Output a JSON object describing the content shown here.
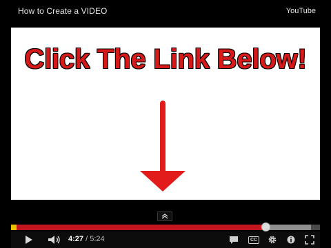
{
  "header": {
    "title": "How to Create a VIDEO",
    "brand": "YouTube"
  },
  "video": {
    "headline": "Click The Link Below!",
    "arrow_icon": "down-arrow-icon",
    "colors": {
      "headline": "#d61a1a",
      "arrow": "#e21b1b",
      "background": "#ffffff"
    }
  },
  "player": {
    "current_time": "4:27",
    "separator": " / ",
    "duration": "5:24",
    "progress_fraction": 0.824,
    "buffered_fraction": 0.97,
    "colors": {
      "played": "#c4161c",
      "buffered": "#8f8f8f",
      "track": "#4a4a4a",
      "start_marker": "#e8c000"
    },
    "icons": [
      "chevron-up-icon",
      "play-icon",
      "volume-icon",
      "annotations-icon",
      "captions-icon",
      "settings-icon",
      "info-icon",
      "fullscreen-icon"
    ],
    "captions_label": "CC"
  }
}
